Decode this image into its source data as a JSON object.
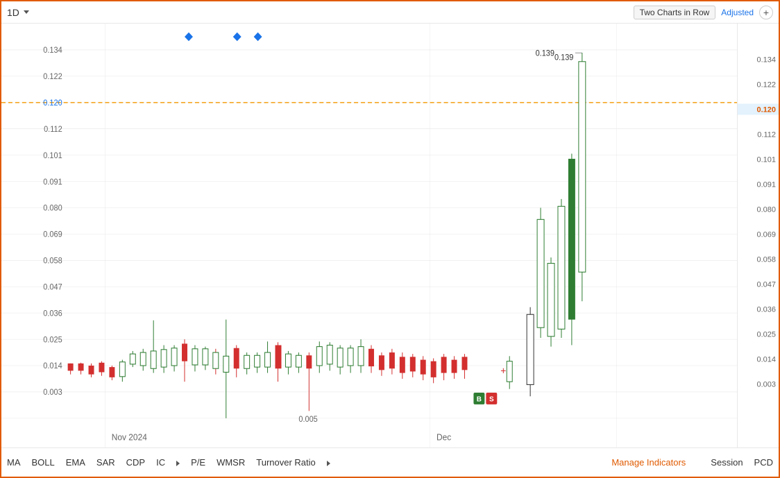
{
  "header": {
    "timeframe": "1D",
    "two_charts_label": "Two Charts in Row",
    "adjusted_label": "Adjusted",
    "add_label": "+"
  },
  "chart": {
    "current_price": "0.120",
    "price_high": "0.139",
    "y_axis_labels": [
      "0.134",
      "0.122",
      "0.120",
      "0.112",
      "0.101",
      "0.091",
      "0.080",
      "0.069",
      "0.058",
      "0.047",
      "0.036",
      "0.025",
      "0.014",
      "0.003"
    ],
    "y_axis_right_labels": [
      "0.134",
      "0.122",
      "0.120",
      "0.112",
      "0.101",
      "0.091",
      "0.080",
      "0.069",
      "0.058",
      "0.047",
      "0.036",
      "0.025",
      "0.014",
      "0.003"
    ],
    "x_labels": [
      "Nov 2024",
      "Dec"
    ],
    "low_label": "0.005",
    "accent_color": "#f5a623",
    "current_price_color": "#f5a623"
  },
  "indicators": {
    "items": [
      "MA",
      "BOLL",
      "EMA",
      "SAR",
      "CDP",
      "IC",
      "P/E",
      "WMSR",
      "Turnover Ratio"
    ],
    "more_label": ">",
    "manage_label": "Manage Indicators",
    "right_items": [
      "Session",
      "PCD"
    ]
  }
}
